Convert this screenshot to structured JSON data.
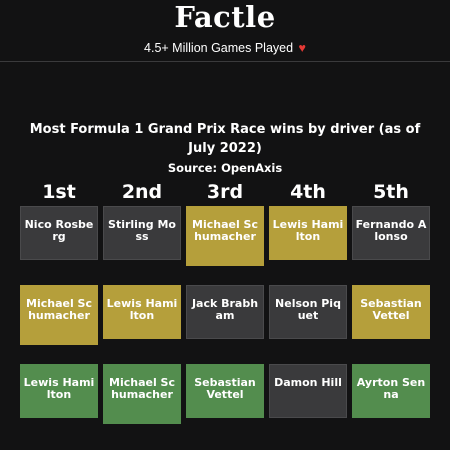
{
  "app": {
    "title": "Factle",
    "tagline": "4.5+ Million Games Played",
    "heart": "♥"
  },
  "puzzle": {
    "question": "Most Formula 1 Grand Prix Race wins by driver (as of July 2022)",
    "source": "Source: OpenAxis",
    "ranks": [
      "1st",
      "2nd",
      "3rd",
      "4th",
      "5th"
    ]
  },
  "colors": {
    "absent": "#3a3a3c",
    "present": "#b59f3b",
    "correct": "#538d4e"
  },
  "guesses": [
    [
      {
        "name": "Nico Rosberg",
        "state": "absent"
      },
      {
        "name": "Stirling Moss",
        "state": "absent"
      },
      {
        "name": "Michael Schumacher",
        "state": "present"
      },
      {
        "name": "Lewis Hamilton",
        "state": "present"
      },
      {
        "name": "Fernando Alonso",
        "state": "absent"
      }
    ],
    [
      {
        "name": "Michael Schumacher",
        "state": "present"
      },
      {
        "name": "Lewis Hamilton",
        "state": "present"
      },
      {
        "name": "Jack Brabham",
        "state": "absent"
      },
      {
        "name": "Nelson Piquet",
        "state": "absent"
      },
      {
        "name": "Sebastian Vettel",
        "state": "present"
      }
    ],
    [
      {
        "name": "Lewis Hamilton",
        "state": "correct"
      },
      {
        "name": "Michael Schumacher",
        "state": "correct"
      },
      {
        "name": "Sebastian Vettel",
        "state": "correct"
      },
      {
        "name": "Damon Hill",
        "state": "absent"
      },
      {
        "name": "Ayrton Senna",
        "state": "correct"
      }
    ]
  ]
}
